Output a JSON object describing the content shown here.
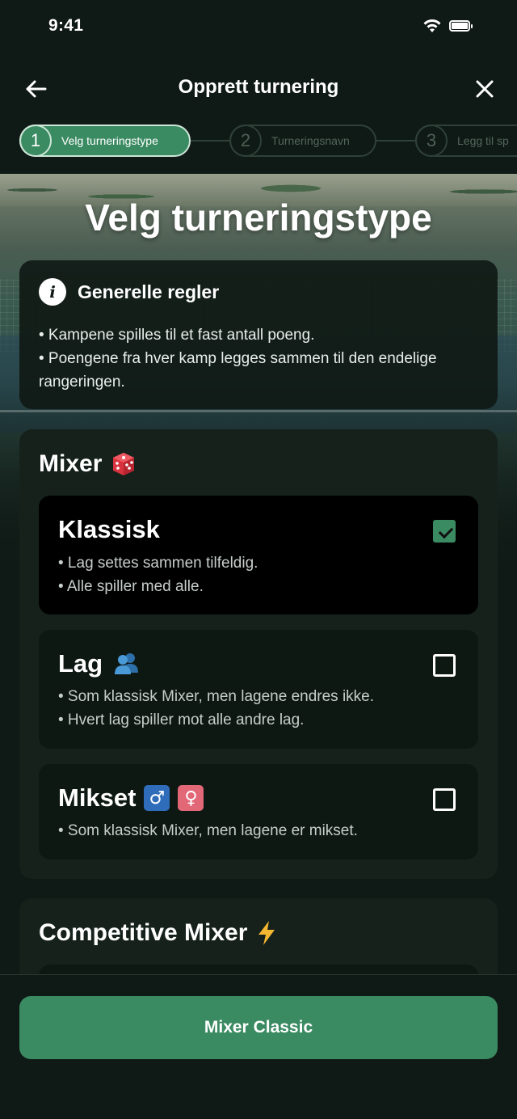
{
  "status_bar": {
    "time": "9:41"
  },
  "header": {
    "title": "Opprett turnering"
  },
  "stepper": [
    {
      "number": "1",
      "label": "Velg turneringstype",
      "active": true
    },
    {
      "number": "2",
      "label": "Turneringsnavn",
      "active": false
    },
    {
      "number": "3",
      "label": "Legg til sp",
      "active": false
    }
  ],
  "page_title": "Velg turneringstype",
  "rules": {
    "icon": "info-icon",
    "title": "Generelle regler",
    "lines": [
      "• Kampene spilles til et fast antall poeng.",
      "• Poengene fra hver kamp legges sammen til den endelige rangeringen."
    ]
  },
  "mixer": {
    "title": "Mixer",
    "emoji": "dice-icon",
    "options": [
      {
        "title": "Klassisk",
        "selected": true,
        "desc": [
          "• Lag settes sammen tilfeldig.",
          "• Alle spiller med alle."
        ]
      },
      {
        "title": "Lag",
        "emoji": "people-icon",
        "selected": false,
        "desc": [
          "• Som klassisk Mixer, men lagene endres ikke.",
          "• Hvert lag spiller mot alle andre lag."
        ]
      },
      {
        "title": "Mikset",
        "badges": [
          "♂",
          "♀"
        ],
        "selected": false,
        "desc": [
          "• Som klassisk Mixer, men lagene er mikset."
        ]
      }
    ]
  },
  "competitive": {
    "title": "Competitive Mixer",
    "emoji": "lightning-icon"
  },
  "primary_button": {
    "label": "Mixer Classic"
  },
  "colors": {
    "accent": "#3a8a62",
    "background": "#0f1915",
    "card": "#16211c",
    "male_badge": "#2f6dbb",
    "female_badge": "#e26777"
  }
}
